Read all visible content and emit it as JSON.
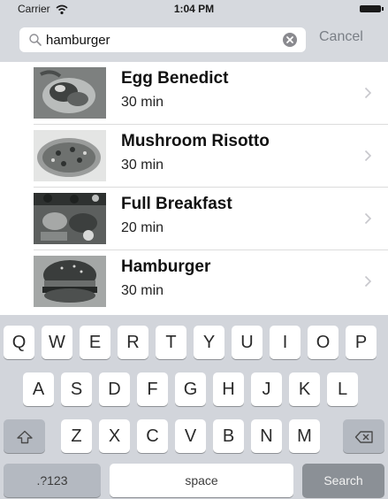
{
  "status_bar": {
    "carrier": "Carrier",
    "time": "1:04 PM",
    "wifi_icon": "wifi-icon",
    "battery_icon": "battery-icon"
  },
  "search": {
    "value": "hamburger",
    "search_icon": "search-icon",
    "clear_icon": "clear-icon",
    "cancel_label": "Cancel"
  },
  "results": [
    {
      "title": "Egg Benedict",
      "subtitle": "30 min",
      "chevron": "chevron-right-icon"
    },
    {
      "title": "Mushroom Risotto",
      "subtitle": "30 min",
      "chevron": "chevron-right-icon"
    },
    {
      "title": "Full Breakfast",
      "subtitle": "20 min",
      "chevron": "chevron-right-icon"
    },
    {
      "title": "Hamburger",
      "subtitle": "30 min",
      "chevron": "chevron-right-icon"
    }
  ],
  "keyboard": {
    "row1": [
      "Q",
      "W",
      "E",
      "R",
      "T",
      "Y",
      "U",
      "I",
      "O",
      "P"
    ],
    "row2": [
      "A",
      "S",
      "D",
      "F",
      "G",
      "H",
      "J",
      "K",
      "L"
    ],
    "row3": [
      "Z",
      "X",
      "C",
      "V",
      "B",
      "N",
      "M"
    ],
    "shift_icon": "shift-icon",
    "delete_icon": "delete-icon",
    "numbers_label": ".?123",
    "space_label": "space",
    "search_label": "Search"
  },
  "colors": {
    "search_bar_background": "#d6d9de",
    "keyboard_background": "#d2d5db",
    "cancel_text": "#7a7f86",
    "search_key": "#8b9096"
  }
}
